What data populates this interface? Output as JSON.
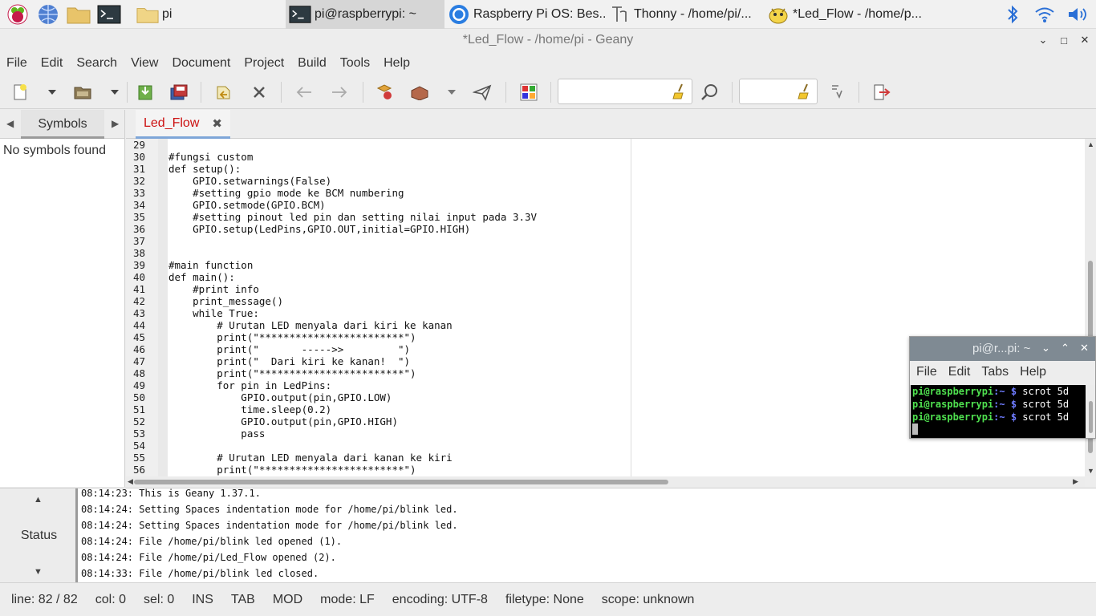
{
  "taskbar": {
    "tasks": [
      {
        "label": "pi",
        "icon": "folder-icon"
      },
      {
        "label": "pi@raspberrypi: ~",
        "icon": "terminal-icon"
      },
      {
        "label": "Raspberry Pi OS: Bes...",
        "icon": "chromium-icon"
      },
      {
        "label": "Thonny  -  /home/pi/...",
        "icon": "thonny-icon"
      },
      {
        "label": "*Led_Flow - /home/p...",
        "icon": "geany-icon"
      }
    ]
  },
  "window": {
    "title": "*Led_Flow - /home/pi - Geany"
  },
  "menu": [
    "File",
    "Edit",
    "Search",
    "View",
    "Document",
    "Project",
    "Build",
    "Tools",
    "Help"
  ],
  "search": {
    "placeholder": "",
    "goto_placeholder": ""
  },
  "sidebar": {
    "tab": "Symbols",
    "message": "No symbols found"
  },
  "editor": {
    "tab_label": "Led_Flow",
    "lines": [
      {
        "n": "29",
        "t": ""
      },
      {
        "n": "30",
        "t": "#fungsi custom"
      },
      {
        "n": "31",
        "t": "def setup():"
      },
      {
        "n": "32",
        "t": "    GPIO.setwarnings(False)"
      },
      {
        "n": "33",
        "t": "    #setting gpio mode ke BCM numbering"
      },
      {
        "n": "34",
        "t": "    GPIO.setmode(GPIO.BCM)"
      },
      {
        "n": "35",
        "t": "    #setting pinout led pin dan setting nilai input pada 3.3V"
      },
      {
        "n": "36",
        "t": "    GPIO.setup(LedPins,GPIO.OUT,initial=GPIO.HIGH)"
      },
      {
        "n": "37",
        "t": ""
      },
      {
        "n": "38",
        "t": ""
      },
      {
        "n": "39",
        "t": "#main function"
      },
      {
        "n": "40",
        "t": "def main():"
      },
      {
        "n": "41",
        "t": "    #print info"
      },
      {
        "n": "42",
        "t": "    print_message()"
      },
      {
        "n": "43",
        "t": "    while True:"
      },
      {
        "n": "44",
        "t": "        # Urutan LED menyala dari kiri ke kanan"
      },
      {
        "n": "45",
        "t": "        print(\"************************\")"
      },
      {
        "n": "46",
        "t": "        print(\"       ----->>         \")"
      },
      {
        "n": "47",
        "t": "        print(\"  Dari kiri ke kanan!  \")"
      },
      {
        "n": "48",
        "t": "        print(\"************************\")"
      },
      {
        "n": "49",
        "t": "        for pin in LedPins:"
      },
      {
        "n": "50",
        "t": "            GPIO.output(pin,GPIO.LOW)"
      },
      {
        "n": "51",
        "t": "            time.sleep(0.2)"
      },
      {
        "n": "52",
        "t": "            GPIO.output(pin,GPIO.HIGH)"
      },
      {
        "n": "53",
        "t": "            pass"
      },
      {
        "n": "54",
        "t": ""
      },
      {
        "n": "55",
        "t": "        # Urutan LED menyala dari kanan ke kiri"
      },
      {
        "n": "56",
        "t": "        print(\"************************\")"
      }
    ]
  },
  "messages": {
    "label": "Status",
    "lines": [
      "08:14:23: This is Geany 1.37.1.",
      "08:14:24: Setting Spaces indentation mode for /home/pi/blink led.",
      "08:14:24: Setting Spaces indentation mode for /home/pi/blink led.",
      "08:14:24: File /home/pi/blink led opened (1).",
      "08:14:24: File /home/pi/Led_Flow opened (2).",
      "08:14:33: File /home/pi/blink led closed."
    ]
  },
  "statusbar": {
    "line": "line: 82 / 82",
    "col": "col: 0",
    "sel": "sel: 0",
    "ins": "INS",
    "tab": "TAB",
    "mod": "MOD",
    "mode": "mode: LF",
    "encoding": "encoding: UTF-8",
    "filetype": "filetype: None",
    "scope": "scope: unknown"
  },
  "terminal": {
    "title": "pi@r...pi: ~",
    "menu": [
      "File",
      "Edit",
      "Tabs",
      "Help"
    ],
    "prompt_user": "pi@raspberrypi",
    "prompt_path": ":~ ",
    "prompt_sign": "$",
    "commands": [
      " scrot 5d",
      " scrot 5d",
      " scrot 5d"
    ]
  },
  "colors": {
    "accent": "#7ea6d8",
    "tab_text": "#cc1111",
    "terminal_bg": "#000000",
    "prompt_green": "#4fe04f"
  }
}
